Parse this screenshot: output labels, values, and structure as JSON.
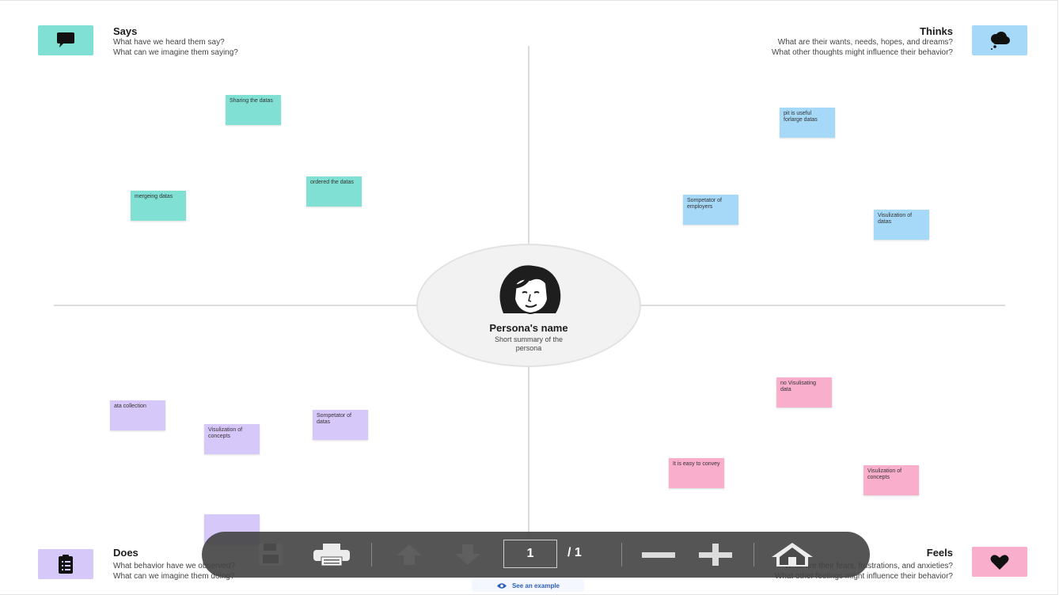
{
  "quadrants": {
    "says": {
      "title": "Says",
      "line1": "What have we heard them say?",
      "line2": "What can we imagine them saying?",
      "color": "#7fe0d3"
    },
    "thinks": {
      "title": "Thinks",
      "line1": "What are their wants, needs, hopes, and dreams?",
      "line2": "What other thoughts might influence their behavior?",
      "color": "#a6d8f7"
    },
    "does": {
      "title": "Does",
      "line1": "What behavior have we observed?",
      "line2": "What can we imagine them doing?",
      "color": "#d7c8fa"
    },
    "feels": {
      "title": "Feels",
      "line1": "What are their fears, frustrations, and anxieties?",
      "line2": "What other feelings might influence their behavior?",
      "color": "#f9aecb"
    }
  },
  "notes": {
    "says": [
      "Sharing the datas",
      "ordered the datas",
      "mergeing datas"
    ],
    "thinks": [
      "pit is useful forlarge datas",
      "Sompetator of employers",
      "Visulization of datas"
    ],
    "does": [
      "ata collection",
      "Visulization of concepts",
      "Sompetator of datas",
      ""
    ],
    "feels": [
      "no Visulisating data",
      "It is easy to convey",
      "Visulization of concepts"
    ]
  },
  "persona": {
    "name": "Persona's name",
    "summary": "Short summary of the persona"
  },
  "toolbar": {
    "current_page": "1",
    "total_pages": "/ 1"
  },
  "example_link": "See an example",
  "icons": [
    "speech-bubble-icon",
    "cloud-icon",
    "clipboard-icon",
    "heart-icon",
    "save-icon",
    "print-icon",
    "arrow-up-icon",
    "arrow-down-icon",
    "zoom-out-icon",
    "zoom-in-icon",
    "home-icon",
    "eye-icon"
  ]
}
